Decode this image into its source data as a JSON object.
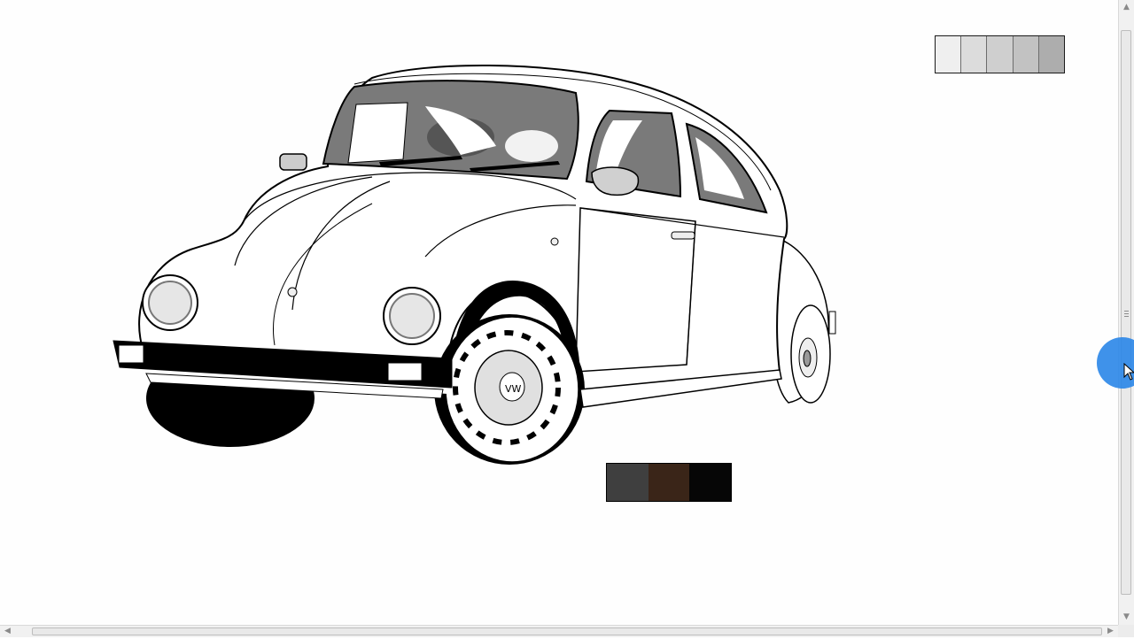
{
  "canvas": {
    "background": "#fefefe"
  },
  "palettes": {
    "gray": {
      "colors": [
        "#efefef",
        "#dcdcdc",
        "#cfcfcf",
        "#c2c2c2",
        "#adadad"
      ]
    },
    "dark": {
      "colors": [
        "#3f3f3f",
        "#3a2518",
        "#060606"
      ]
    }
  },
  "drawing": {
    "subject": "vw-beetle-line-art",
    "window_tint": "#7a7a7a",
    "outline": "#000000"
  },
  "scrollbars": {
    "vertical_thumb_fraction": 0.92,
    "horizontal_thumb_fraction": 0.96
  },
  "cursor": {
    "highlight_color": "#2a86e8"
  },
  "icons": [
    "arrow-up-icon",
    "arrow-down-icon",
    "arrow-left-icon",
    "arrow-right-icon",
    "mouse-pointer-icon"
  ]
}
